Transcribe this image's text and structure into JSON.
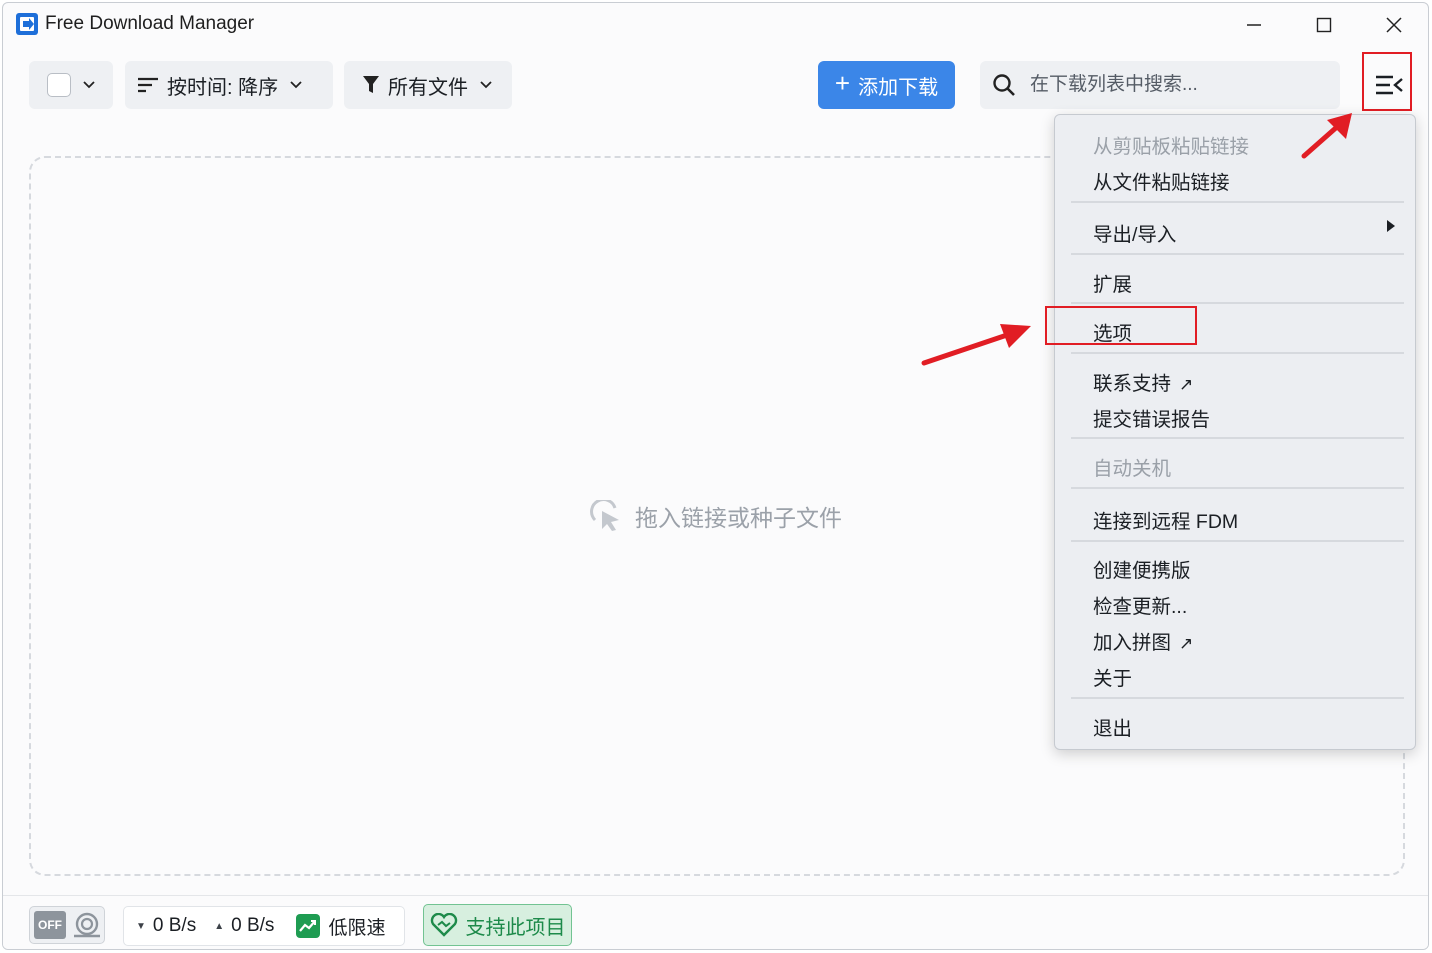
{
  "window": {
    "title": "Free Download Manager",
    "logo_icon": "fdm-logo-icon",
    "controls": [
      "minimize-icon",
      "maximize-icon",
      "close-icon"
    ]
  },
  "toolbar": {
    "sort_label": "按时间: 降序",
    "filter_label": "所有文件",
    "add_download_label": "添加下载",
    "search_placeholder": "在下载列表中搜索...",
    "menu_icon": "hamburger-menu-icon"
  },
  "main": {
    "drop_hint": "拖入链接或种子文件"
  },
  "menu": {
    "items": [
      {
        "label": "从剪贴板粘贴链接",
        "enabled": false
      },
      {
        "label": "从文件粘贴链接",
        "enabled": true
      },
      {
        "label": "导出/导入",
        "enabled": true,
        "submenu": true
      },
      {
        "label": "扩展",
        "enabled": true
      },
      {
        "label": "选项",
        "enabled": true,
        "highlighted": true
      },
      {
        "label": "联系支持",
        "enabled": true,
        "external": true
      },
      {
        "label": "提交错误报告",
        "enabled": true
      },
      {
        "label": "自动关机",
        "enabled": false
      },
      {
        "label": "连接到远程 FDM",
        "enabled": true
      },
      {
        "label": "创建便携版",
        "enabled": true
      },
      {
        "label": "检查更新...",
        "enabled": true
      },
      {
        "label": "加入拼图",
        "enabled": true,
        "external": true
      },
      {
        "label": "关于",
        "enabled": true
      },
      {
        "label": "退出",
        "enabled": true
      }
    ]
  },
  "statusbar": {
    "snail_mode": "OFF",
    "download_speed": "0 B/s",
    "upload_speed": "0 B/s",
    "speed_limit_label": "低限速",
    "support_label": "支持此项目"
  },
  "colors": {
    "accent": "#3b86e8",
    "highlight_red": "#e11d24",
    "support_green": "#1d8a4a"
  }
}
